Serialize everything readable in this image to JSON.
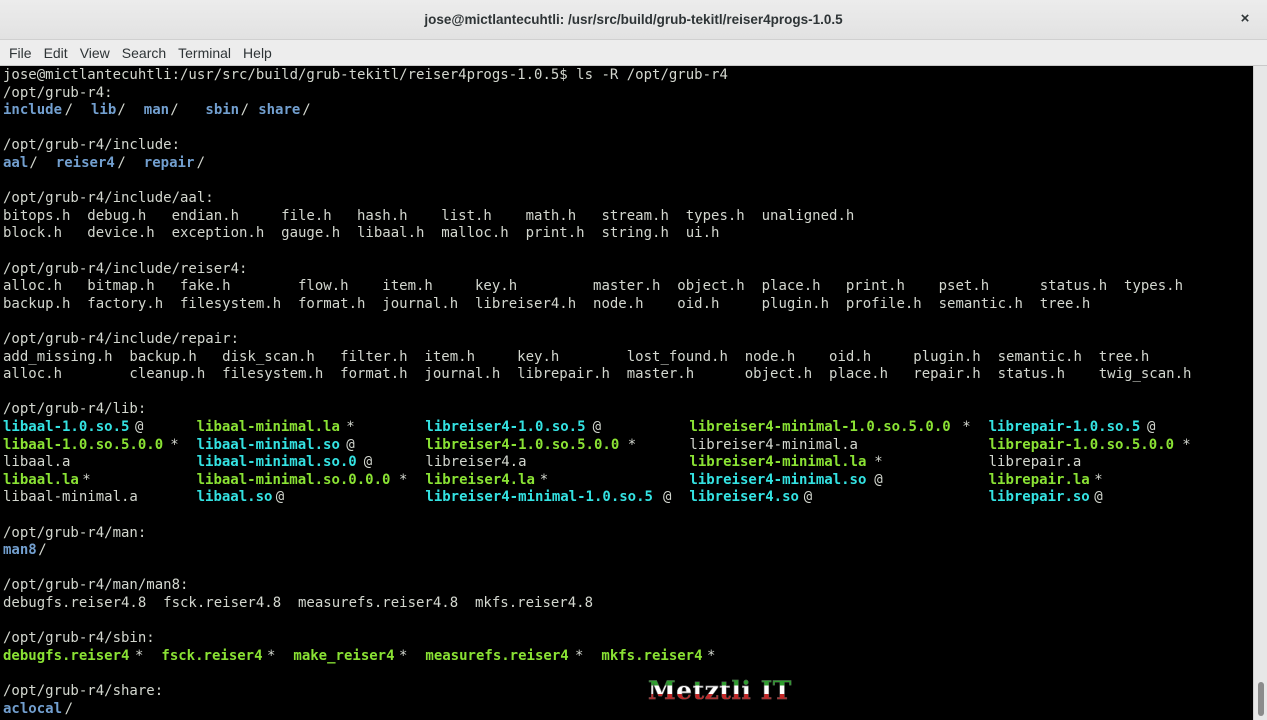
{
  "window": {
    "title": "jose@mictlantecuhtli: /usr/src/build/grub-tekitl/reiser4progs-1.0.5",
    "close_glyph": "×"
  },
  "menu": [
    "File",
    "Edit",
    "View",
    "Search",
    "Terminal",
    "Help"
  ],
  "colors": {
    "background": "#000000",
    "text": "#d3d7cf",
    "directory": "#729fcf",
    "executable": "#8ae234",
    "symlink": "#34e2e2"
  },
  "terminal_lines": [
    {
      "text": "jose@mictlantecuhtli:/usr/src/build/grub-tekitl/reiser4progs-1.0.5$ ls -R /opt/grub-r4"
    },
    {
      "text": "/opt/grub-r4:"
    },
    {
      "cells": [
        {
          "t": "include",
          "c": "dir"
        },
        {
          "t": "/",
          "c": "plain"
        },
        {
          "t": "lib",
          "c": "dir"
        },
        {
          "t": "/",
          "c": "plain"
        },
        {
          "t": "man",
          "c": "dir"
        },
        {
          "t": "/",
          "c": "plain"
        },
        {
          "t": "sbin",
          "c": "dir"
        },
        {
          "t": "/",
          "c": "plain"
        },
        {
          "t": "share",
          "c": "dir"
        },
        {
          "t": "/",
          "c": "plain"
        }
      ],
      "cols": [
        0,
        7,
        10,
        13,
        16,
        19,
        23,
        27,
        29,
        34
      ]
    },
    {
      "text": ""
    },
    {
      "text": "/opt/grub-r4/include:"
    },
    {
      "cells": [
        {
          "t": "aal",
          "c": "dir"
        },
        {
          "t": "/",
          "c": "plain"
        },
        {
          "t": "reiser4",
          "c": "dir"
        },
        {
          "t": "/",
          "c": "plain"
        },
        {
          "t": "repair",
          "c": "dir"
        },
        {
          "t": "/",
          "c": "plain"
        }
      ],
      "cols": [
        0,
        3,
        6,
        13,
        16,
        22
      ]
    },
    {
      "text": ""
    },
    {
      "text": "/opt/grub-r4/include/aal:"
    },
    {
      "text": "bitops.h  debug.h   endian.h     file.h   hash.h    list.h    math.h   stream.h  types.h  unaligned.h"
    },
    {
      "text": "block.h   device.h  exception.h  gauge.h  libaal.h  malloc.h  print.h  string.h  ui.h"
    },
    {
      "text": ""
    },
    {
      "text": "/opt/grub-r4/include/reiser4:"
    },
    {
      "text": "alloc.h   bitmap.h   fake.h        flow.h    item.h     key.h         master.h  object.h  place.h   print.h    pset.h      status.h  types.h"
    },
    {
      "text": "backup.h  factory.h  filesystem.h  format.h  journal.h  libreiser4.h  node.h    oid.h     plugin.h  profile.h  semantic.h  tree.h"
    },
    {
      "text": ""
    },
    {
      "text": "/opt/grub-r4/include/repair:"
    },
    {
      "text": "add_missing.h  backup.h   disk_scan.h   filter.h  item.h     key.h        lost_found.h  node.h    oid.h     plugin.h  semantic.h  tree.h"
    },
    {
      "text": "alloc.h        cleanup.h  filesystem.h  format.h  journal.h  librepair.h  master.h      object.h  place.h   repair.h  status.h    twig_scan.h"
    },
    {
      "text": ""
    },
    {
      "text": "/opt/grub-r4/lib:"
    },
    {
      "cells": [
        {
          "t": "libaal-1.0.so.5",
          "c": "lnk"
        },
        {
          "t": "@",
          "c": "plain"
        },
        {
          "t": "libaal-minimal.la",
          "c": "exe"
        },
        {
          "t": "*",
          "c": "plain"
        },
        {
          "t": "libreiser4-1.0.so.5",
          "c": "lnk"
        },
        {
          "t": "@",
          "c": "plain"
        },
        {
          "t": "libreiser4-minimal-1.0.so.5.0.0",
          "c": "exe"
        },
        {
          "t": "*",
          "c": "plain"
        },
        {
          "t": "librepair-1.0.so.5",
          "c": "lnk"
        },
        {
          "t": "@",
          "c": "plain"
        }
      ],
      "cols": [
        0,
        15,
        22,
        39,
        48,
        67,
        78,
        109,
        112,
        130
      ]
    },
    {
      "cells": [
        {
          "t": "libaal-1.0.so.5.0.0",
          "c": "exe"
        },
        {
          "t": "*",
          "c": "plain"
        },
        {
          "t": "libaal-minimal.so",
          "c": "lnk"
        },
        {
          "t": "@",
          "c": "plain"
        },
        {
          "t": "libreiser4-1.0.so.5.0.0",
          "c": "exe"
        },
        {
          "t": "*",
          "c": "plain"
        },
        {
          "t": "libreiser4-minimal.a",
          "c": "plain"
        },
        {
          "t": "librepair-1.0.so.5.0.0",
          "c": "exe"
        },
        {
          "t": "*",
          "c": "plain"
        }
      ],
      "cols": [
        0,
        19,
        22,
        39,
        48,
        71,
        78,
        112,
        134
      ]
    },
    {
      "cells": [
        {
          "t": "libaal.a",
          "c": "plain"
        },
        {
          "t": "libaal-minimal.so.0",
          "c": "lnk"
        },
        {
          "t": "@",
          "c": "plain"
        },
        {
          "t": "libreiser4.a",
          "c": "plain"
        },
        {
          "t": "libreiser4-minimal.la",
          "c": "exe"
        },
        {
          "t": "*",
          "c": "plain"
        },
        {
          "t": "librepair.a",
          "c": "plain"
        }
      ],
      "cols": [
        0,
        22,
        41,
        48,
        78,
        99,
        112
      ]
    },
    {
      "cells": [
        {
          "t": "libaal.la",
          "c": "exe"
        },
        {
          "t": "*",
          "c": "plain"
        },
        {
          "t": "libaal-minimal.so.0.0.0",
          "c": "exe"
        },
        {
          "t": "*",
          "c": "plain"
        },
        {
          "t": "libreiser4.la",
          "c": "exe"
        },
        {
          "t": "*",
          "c": "plain"
        },
        {
          "t": "libreiser4-minimal.so",
          "c": "lnk"
        },
        {
          "t": "@",
          "c": "plain"
        },
        {
          "t": "librepair.la",
          "c": "exe"
        },
        {
          "t": "*",
          "c": "plain"
        }
      ],
      "cols": [
        0,
        9,
        22,
        45,
        48,
        61,
        78,
        99,
        112,
        124
      ]
    },
    {
      "cells": [
        {
          "t": "libaal-minimal.a",
          "c": "plain"
        },
        {
          "t": "libaal.so",
          "c": "lnk"
        },
        {
          "t": "@",
          "c": "plain"
        },
        {
          "t": "libreiser4-minimal-1.0.so.5",
          "c": "lnk"
        },
        {
          "t": "@",
          "c": "plain"
        },
        {
          "t": "libreiser4.so",
          "c": "lnk"
        },
        {
          "t": "@",
          "c": "plain"
        },
        {
          "t": "librepair.so",
          "c": "lnk"
        },
        {
          "t": "@",
          "c": "plain"
        }
      ],
      "cols": [
        0,
        22,
        31,
        48,
        75,
        78,
        91,
        112,
        124
      ]
    },
    {
      "text": ""
    },
    {
      "text": "/opt/grub-r4/man:"
    },
    {
      "cells": [
        {
          "t": "man8",
          "c": "dir"
        },
        {
          "t": "/",
          "c": "plain"
        }
      ],
      "cols": [
        0,
        4
      ]
    },
    {
      "text": ""
    },
    {
      "text": "/opt/grub-r4/man/man8:"
    },
    {
      "text": "debugfs.reiser4.8  fsck.reiser4.8  measurefs.reiser4.8  mkfs.reiser4.8"
    },
    {
      "text": ""
    },
    {
      "text": "/opt/grub-r4/sbin:"
    },
    {
      "cells": [
        {
          "t": "debugfs.reiser4",
          "c": "exe"
        },
        {
          "t": "*",
          "c": "plain"
        },
        {
          "t": "fsck.reiser4",
          "c": "exe"
        },
        {
          "t": "*",
          "c": "plain"
        },
        {
          "t": "make_reiser4",
          "c": "exe"
        },
        {
          "t": "*",
          "c": "plain"
        },
        {
          "t": "measurefs.reiser4",
          "c": "exe"
        },
        {
          "t": "*",
          "c": "plain"
        },
        {
          "t": "mkfs.reiser4",
          "c": "exe"
        },
        {
          "t": "*",
          "c": "plain"
        }
      ],
      "cols": [
        0,
        15,
        18,
        30,
        33,
        45,
        48,
        65,
        68,
        80
      ]
    },
    {
      "text": ""
    },
    {
      "text": "/opt/grub-r4/share:"
    },
    {
      "cells": [
        {
          "t": "aclocal",
          "c": "dir"
        },
        {
          "t": "/",
          "c": "plain"
        }
      ],
      "cols": [
        0,
        7
      ]
    }
  ],
  "watermark": "Metztli IT"
}
